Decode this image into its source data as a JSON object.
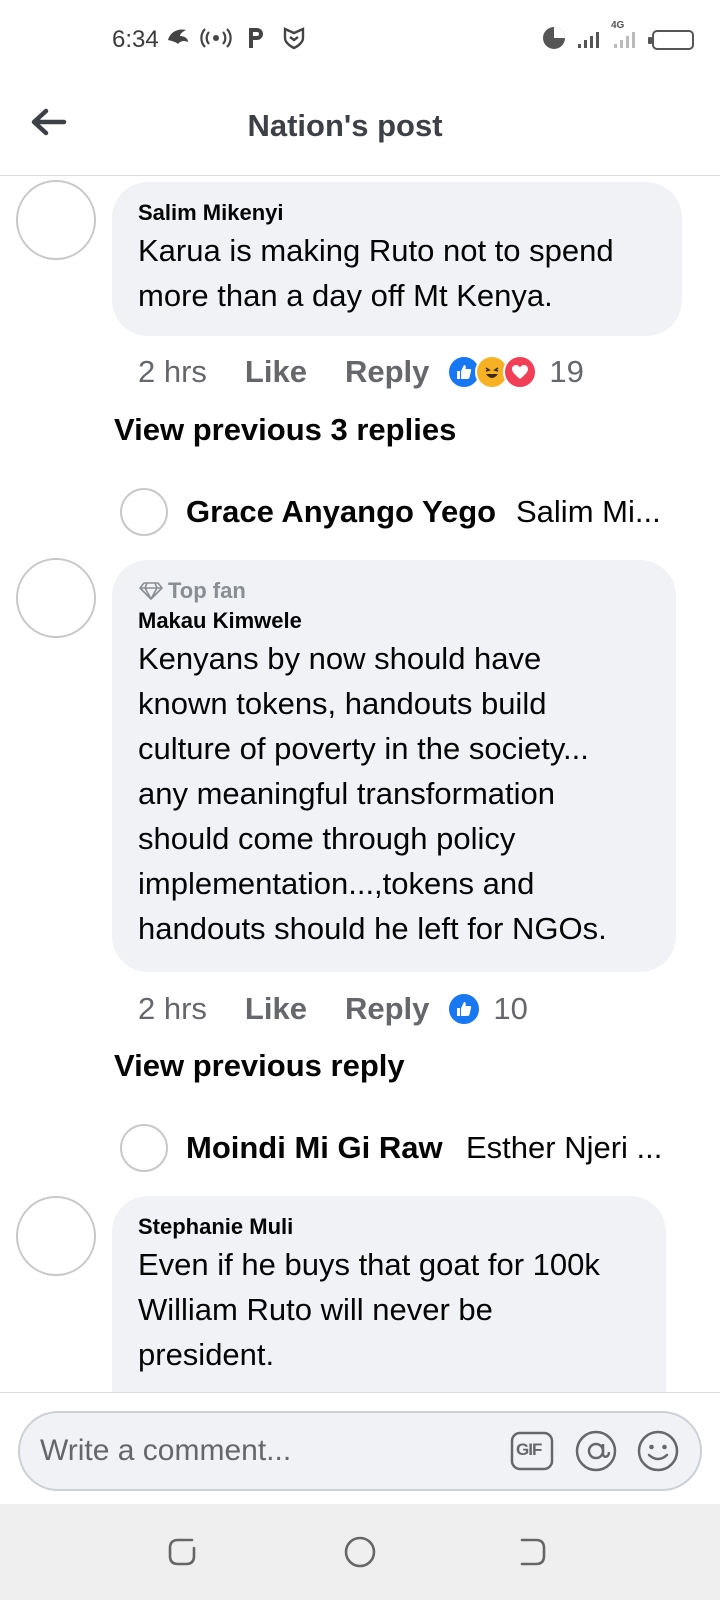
{
  "status_bar": {
    "time": "6:34",
    "network_label": "4G"
  },
  "header": {
    "title": "Nation's post"
  },
  "comments": [
    {
      "author": "Salim Mikenyi",
      "text": "Karua is making Ruto not to spend\nmore than a day off Mt Kenya.",
      "time": "2 hrs",
      "like_label": "Like",
      "reply_label": "Reply",
      "reactions": [
        "like",
        "haha",
        "love"
      ],
      "reaction_count": "19",
      "view_previous": "View previous 3 replies",
      "reply_preview": {
        "name": "Grace Anyango Yego",
        "text": "Salim Mi..."
      }
    },
    {
      "badge": "Top fan",
      "author": "Makau Kimwele",
      "text": "Kenyans by now should have\nknown tokens, handouts build\nculture of poverty in the society...\nany meaningful transformation\nshould come through policy\nimplementation...,tokens and\nhandouts should he left for NGOs.",
      "time": "2 hrs",
      "like_label": "Like",
      "reply_label": "Reply",
      "reactions": [
        "like"
      ],
      "reaction_count": "10",
      "view_previous": "View previous reply",
      "reply_preview": {
        "name": "Moindi Mi Gi Raw",
        "text": "Esther Njeri ..."
      }
    },
    {
      "author": "Stephanie Muli",
      "text": "Even if he buys that goat for 100k\nWilliam Ruto will never be\npresident."
    }
  ],
  "composer": {
    "placeholder": "Write a comment...",
    "gif_label": "GIF"
  },
  "colors": {
    "bubble": "#f0f2f5",
    "like_blue": "#1877f2",
    "secondary_text": "#65676b",
    "love_red": "#f33e58",
    "haha_yellow": "#f7b125"
  }
}
